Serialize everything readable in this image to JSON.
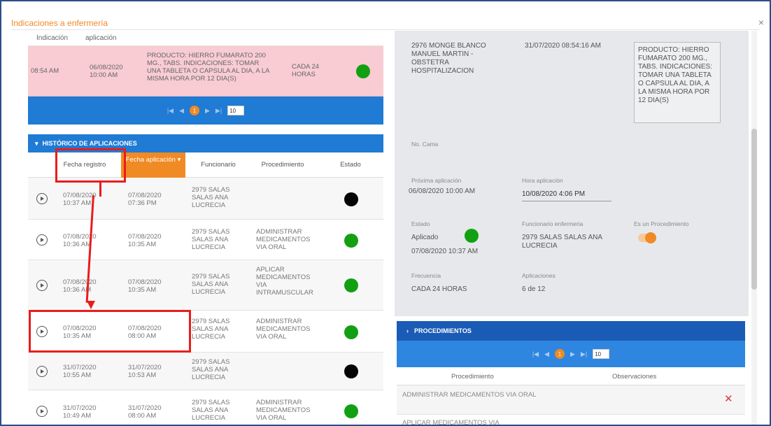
{
  "modal": {
    "title": "Indicaciones a enfermería",
    "close_label": "×"
  },
  "current_table": {
    "header": {
      "indicacion": "Indicación",
      "aplicacion": "aplicación"
    },
    "row": {
      "hora": "08:54 AM",
      "aplicacion": "06/08/2020 10:00 AM",
      "producto": "PRODUCTO: HIERRO FUMARATO 200 MG., TABS. INDICACIONES: TOMAR UNA TABLETA O CAPSULA AL DIA, A LA MISMA HORA POR 12 DIA(S)",
      "frecuencia": "CADA 24 HORAS",
      "estado_color": "#12a012"
    },
    "pager": {
      "first": "|◀",
      "prev": "◀",
      "page": "1",
      "next": "▶",
      "last": "▶|",
      "size": "10"
    }
  },
  "historico": {
    "title": "HISTÓRICO DE APLICACIONES",
    "columns": {
      "fecha_registro": "Fecha registro",
      "fecha_aplicacion": "Fecha aplicación",
      "funcionario": "Funcionario",
      "procedimiento": "Procedimiento",
      "estado": "Estado"
    },
    "rows": [
      {
        "registro": "07/08/2020 10:37 AM",
        "aplicacion": "07/08/2020 07:36 PM",
        "funcionario": "2979 SALAS SALAS ANA LUCRECIA",
        "procedimiento": "",
        "estado": "black"
      },
      {
        "registro": "07/08/2020 10:36 AM",
        "aplicacion": "07/08/2020 10:35 AM",
        "funcionario": "2979 SALAS SALAS ANA LUCRECIA",
        "procedimiento": "ADMINISTRAR MEDICAMENTOS VIA ORAL",
        "estado": "green"
      },
      {
        "registro": "07/08/2020 10:36 AM",
        "aplicacion": "07/08/2020 10:35 AM",
        "funcionario": "2979 SALAS SALAS ANA LUCRECIA",
        "procedimiento": "APLICAR MEDICAMENTOS VIA INTRAMUSCULAR",
        "estado": "green"
      },
      {
        "registro": "07/08/2020 10:35 AM",
        "aplicacion": "07/08/2020 08:00 AM",
        "funcionario": "2979 SALAS SALAS ANA LUCRECIA",
        "procedimiento": "ADMINISTRAR MEDICAMENTOS VIA ORAL",
        "estado": "green"
      },
      {
        "registro": "31/07/2020 10:55 AM",
        "aplicacion": "31/07/2020 10:53 AM",
        "funcionario": "2979 SALAS SALAS ANA LUCRECIA",
        "procedimiento": "",
        "estado": "black"
      },
      {
        "registro": "31/07/2020 10:49 AM",
        "aplicacion": "31/07/2020 08:00 AM",
        "funcionario": "2979 SALAS SALAS ANA LUCRECIA",
        "procedimiento": "ADMINISTRAR MEDICAMENTOS VIA ORAL",
        "estado": "green"
      }
    ]
  },
  "detail": {
    "medico": "2976 MONGE BLANCO MANUEL MARTIN - OBSTETRA HOSPITALIZACION",
    "fecha_indicacion": "31/07/2020 08:54:16 AM",
    "producto": "PRODUCTO: HIERRO FUMARATO 200 MG., TABS. INDICACIONES: TOMAR UNA TABLETA O CAPSULA AL DIA, A LA MISMA HORA POR 12 DIA(S)",
    "cama_label": "No. Cama",
    "proxima_label": "Próxima aplicación",
    "proxima_value": "06/08/2020 10:00 AM",
    "hora_label": "Hora aplicación",
    "hora_value": "10/08/2020 4:06 PM",
    "estado_label": "Estado",
    "estado_value": "Aplicado",
    "estado_fecha": "07/08/2020 10:37 AM",
    "funcionario_label": "Funcionario enfermeria",
    "funcionario_value": "2979 SALAS SALAS ANA LUCRECIA",
    "es_proc_label": "Es un Procedimiento",
    "frecuencia_label": "Frecuencia",
    "frecuencia_value": "CADA 24 HORAS",
    "aplicaciones_label": "Aplicaciones",
    "aplicaciones_value": "6 de 12"
  },
  "procedimientos": {
    "title": "PROCEDIMIENTOS",
    "pager": {
      "first": "|◀",
      "prev": "◀",
      "page": "1",
      "next": "▶",
      "last": "▶|",
      "size": "10"
    },
    "columns": {
      "procedimiento": "Procedimiento",
      "observaciones": "Observaciones"
    },
    "rows": [
      {
        "procedimiento": "ADMINISTRAR MEDICAMENTOS VIA ORAL",
        "delete": "✕"
      },
      {
        "procedimiento": "APLICAR MEDICAMENTOS VIA",
        "delete": ""
      }
    ]
  },
  "colors": {
    "accent": "#f08a24",
    "primary_blue": "#1f7bd4",
    "highlight": "#ea1c1c",
    "pink_row": "#f8ccd2"
  }
}
